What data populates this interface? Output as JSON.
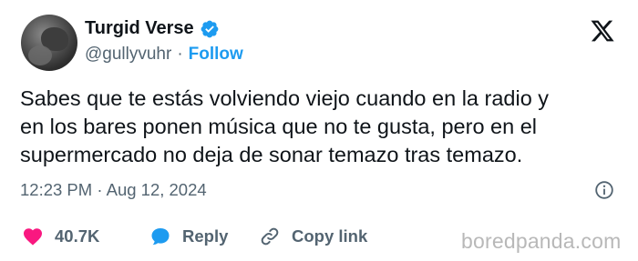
{
  "author": {
    "display_name": "Turgid Verse",
    "handle": "@gullyvuhr",
    "separator": "·",
    "follow_label": "Follow",
    "verified": true
  },
  "icons": {
    "avatar": "avatar",
    "verified": "verified-badge-icon",
    "platform": "x-logo-icon",
    "info": "info-icon",
    "like": "heart-icon",
    "reply": "speech-bubble-icon",
    "copy_link": "link-icon"
  },
  "tweet": {
    "lines": [
      "Sabes que te estás volviendo viejo cuando en la radio y",
      "en los bares ponen música que no te gusta, pero en el",
      "supermercado no deja de sonar temazo tras temazo."
    ],
    "timestamp": "12:23 PM · Aug 12, 2024"
  },
  "actions": {
    "like_count": "40.7K",
    "reply_label": "Reply",
    "copy_link_label": "Copy link"
  },
  "watermark": "boredpanda.com",
  "colors": {
    "accent": "#1d9bf0",
    "like": "#f91880",
    "text": "#0f1419",
    "muted": "#536471",
    "watermark": "#b8b8b8"
  }
}
